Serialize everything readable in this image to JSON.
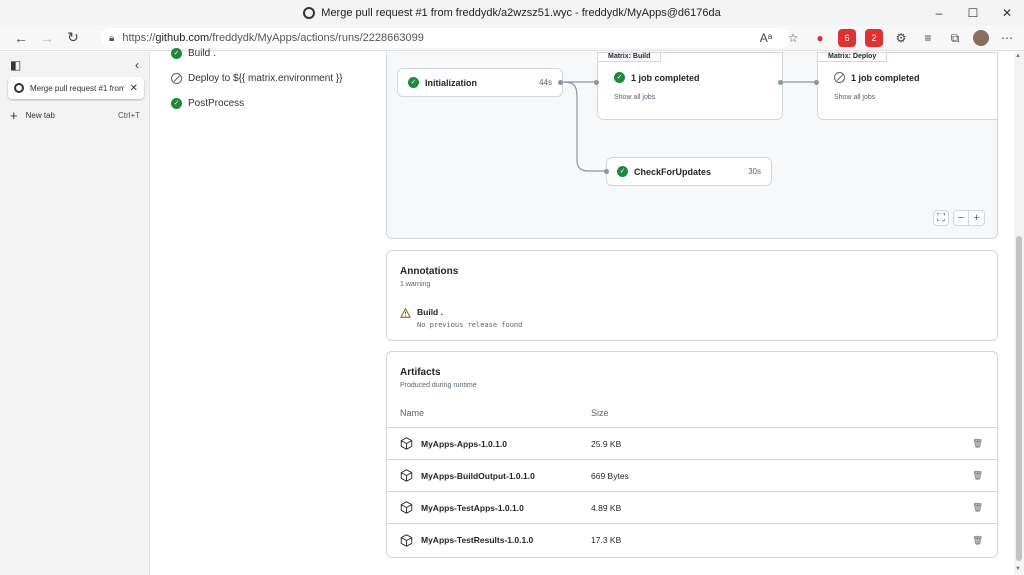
{
  "window": {
    "title": "Merge pull request #1 from freddydk/a2wzsz51.wyc - freddydk/MyApps@d6176da",
    "controls": {
      "minimize": "–",
      "maximize": "☐",
      "close": "✕"
    }
  },
  "browser": {
    "url_prefix": "https://",
    "url_host": "github.com",
    "url_path": "/freddydk/MyApps/actions/runs/2228663099",
    "nav": {
      "back": "←",
      "forward": "→",
      "refresh": "↻"
    },
    "toolbar_icons": [
      "read-aloud-icon",
      "favorite-icon",
      "extension-icon",
      "extension-icon",
      "extension-icon",
      "extensions-puzzle-icon",
      "favorites-icon",
      "collections-icon",
      "profile-avatar",
      "more-icon"
    ],
    "toolbar_labels": {
      "read_aloud": "Aᵃ",
      "favorite": "☆",
      "more": "⋯",
      "ext1": "●",
      "ext2": "6",
      "ext3": "2",
      "ext4": "⚙",
      "fav_list": "≡",
      "collections": "⧉"
    }
  },
  "tab_sidebar": {
    "collapse_icon": "‹",
    "active_tab_label": "Merge pull request #1 from",
    "close": "✕",
    "new_tab_label": "New tab",
    "new_tab_shortcut": "Ctrl+T",
    "plus": "+"
  },
  "jobs": [
    {
      "label": "Build .",
      "status": "success"
    },
    {
      "label": "Deploy to ${{ matrix.environment }}",
      "status": "skipped"
    },
    {
      "label": "PostProcess",
      "status": "success"
    }
  ],
  "graph": {
    "initialization": {
      "label": "Initialization",
      "duration": "44s",
      "status": "success"
    },
    "matrix_build": {
      "header": "Matrix: Build",
      "summary": "1 job completed",
      "link": "Show all jobs",
      "status": "success"
    },
    "matrix_deploy": {
      "header": "Matrix: Deploy",
      "summary": "1 job completed",
      "link": "Show all jobs",
      "status": "skipped"
    },
    "check_for_updates": {
      "label": "CheckForUpdates",
      "duration": "30s",
      "status": "success"
    },
    "zoom": {
      "fullscreen": "⛶",
      "minus": "−",
      "plus": "+"
    }
  },
  "annotations": {
    "title": "Annotations",
    "subtitle": "1 warning",
    "items": [
      {
        "title": "Build .",
        "message": "No previous release found",
        "level": "warning"
      }
    ]
  },
  "artifacts": {
    "title": "Artifacts",
    "subtitle": "Produced during runtime",
    "columns": {
      "name": "Name",
      "size": "Size"
    },
    "rows": [
      {
        "name": "MyApps-Apps-1.0.1.0",
        "size": "25.9 KB"
      },
      {
        "name": "MyApps-BuildOutput-1.0.1.0",
        "size": "669 Bytes"
      },
      {
        "name": "MyApps-TestApps-1.0.1.0",
        "size": "4.89 KB"
      },
      {
        "name": "MyApps-TestResults-1.0.1.0",
        "size": "17.3 KB"
      }
    ]
  },
  "colors": {
    "success": "#1f883d",
    "skipped": "#59636e",
    "warning": "#9a6700",
    "border": "#d0d7de",
    "muted": "#59636e"
  }
}
